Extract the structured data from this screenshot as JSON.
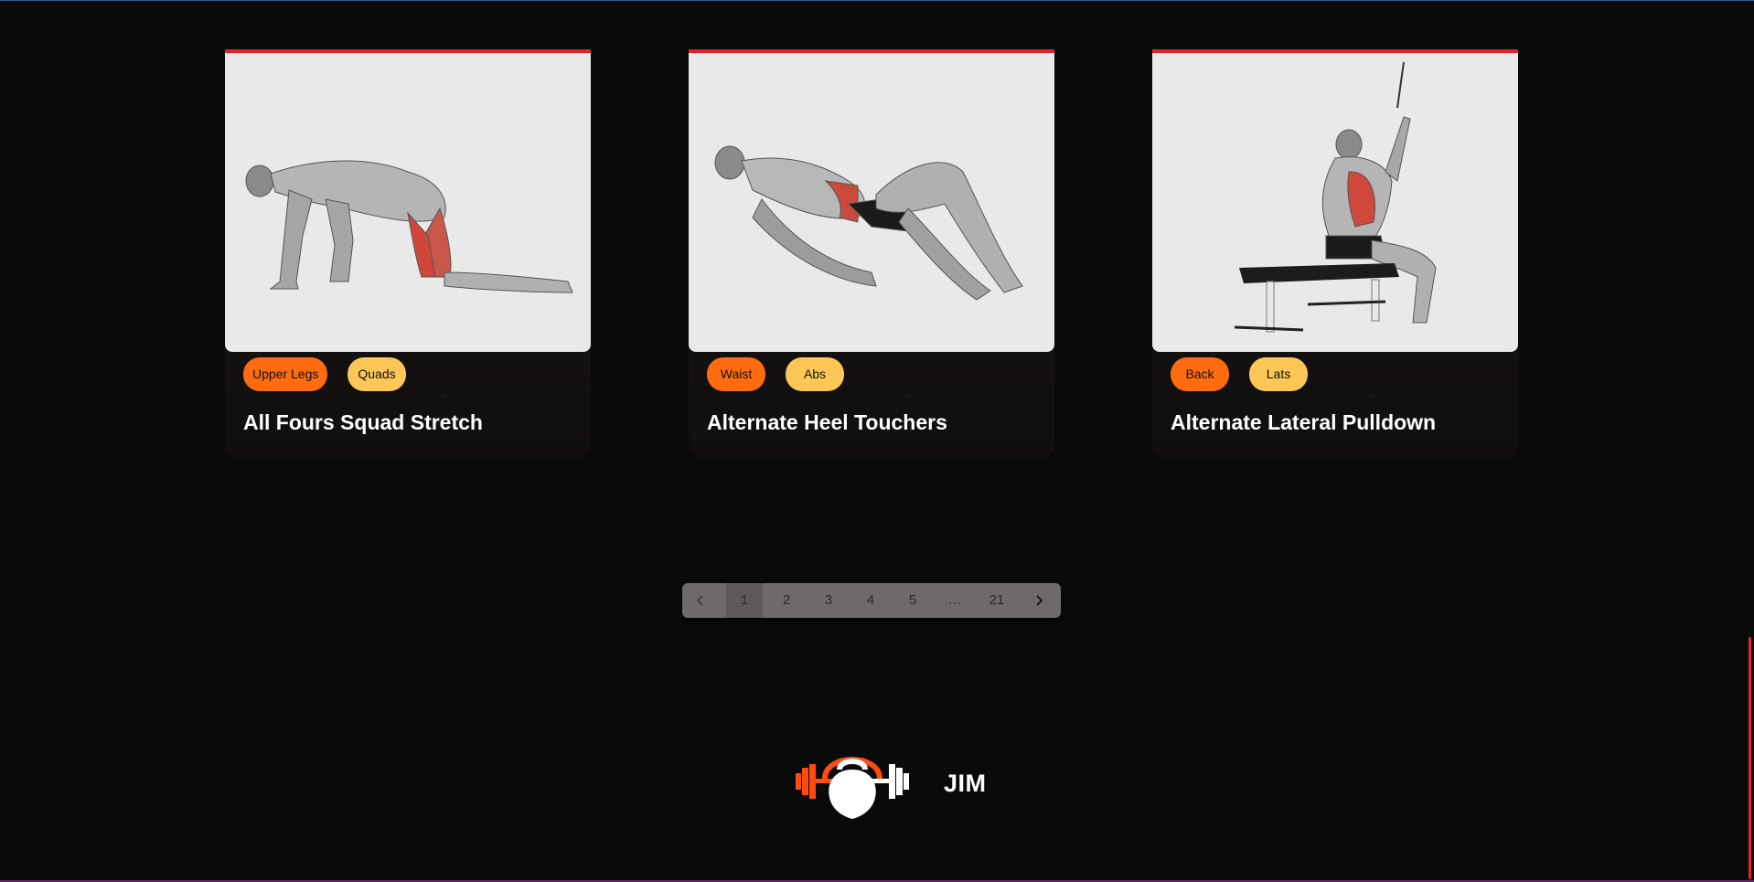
{
  "exercises": [
    {
      "name": "All Fours Squad Stretch",
      "body_part": "Upper Legs",
      "target": "Quads",
      "illustration": "kneeling-quad-stretch-figure"
    },
    {
      "name": "Alternate Heel Touchers",
      "body_part": "Waist",
      "target": "Abs",
      "illustration": "lying-heel-touch-figure"
    },
    {
      "name": "Alternate Lateral Pulldown",
      "body_part": "Back",
      "target": "Lats",
      "illustration": "seated-cable-pulldown-figure"
    }
  ],
  "pagination": {
    "prev_icon": "chevron-left-icon",
    "pages": [
      "1",
      "2",
      "3",
      "4",
      "5",
      "…",
      "21"
    ],
    "current": "1",
    "next_icon": "chevron-right-icon"
  },
  "footer": {
    "logo_icon": "kettlebell-barbell-logo",
    "name": "JIM"
  },
  "colors": {
    "background": "#0b0a0a",
    "accent_red": "#e4222b",
    "body_part_tag": "#ff6c0f",
    "target_tag": "#fcc757",
    "logo_orange": "#ff4a12"
  }
}
